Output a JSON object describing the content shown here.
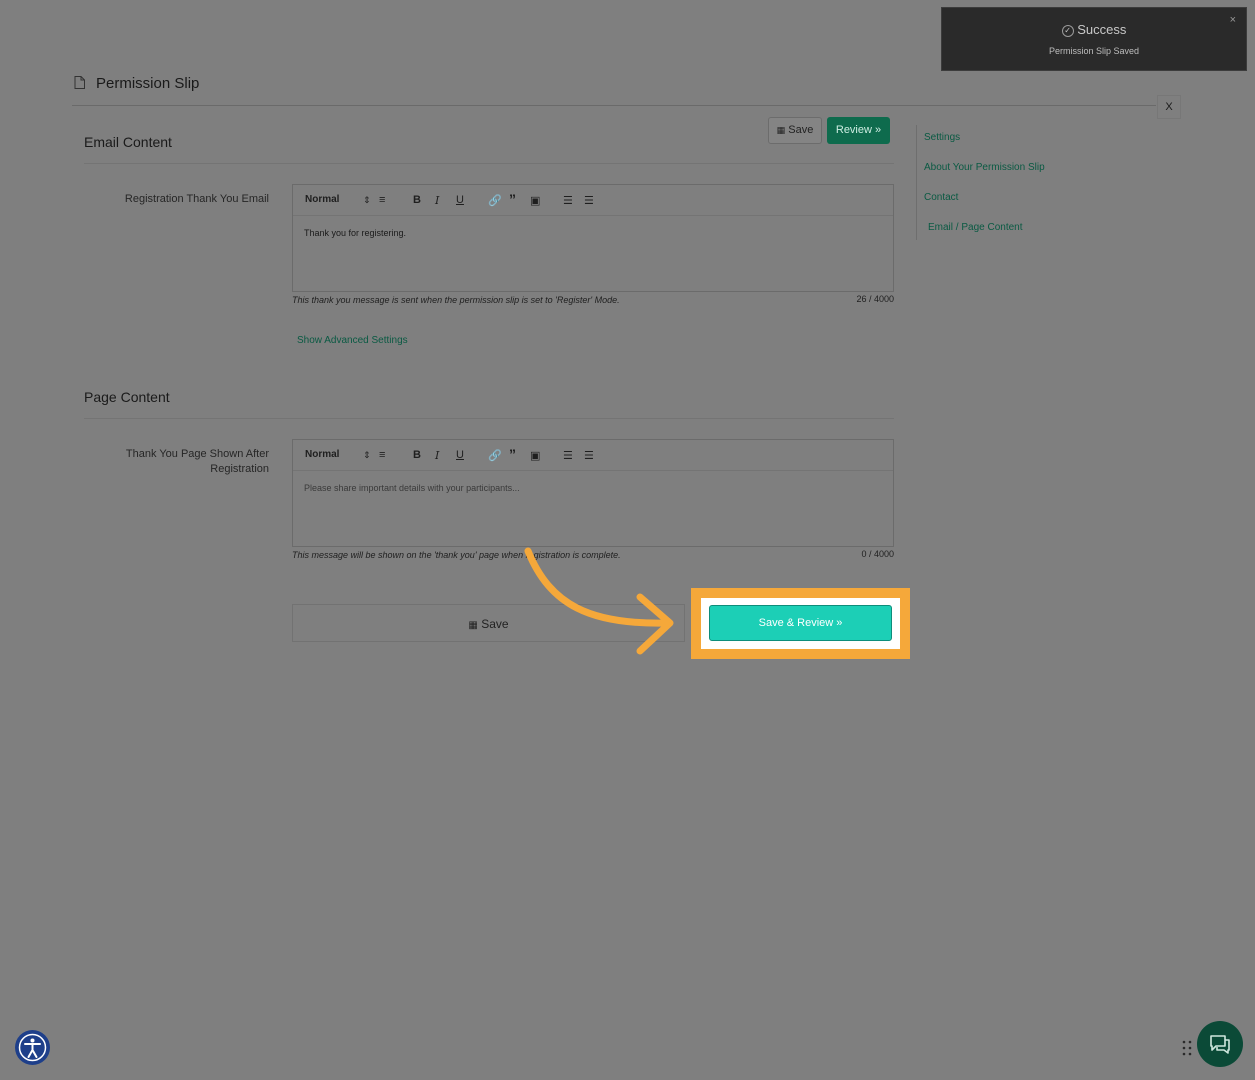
{
  "page": {
    "title": "Permission Slip",
    "close_label": "X"
  },
  "toolbar_top": {
    "save_label": "Save",
    "review_label": "Review »"
  },
  "email_section": {
    "title": "Email Content",
    "field_label": "Registration Thank You Email",
    "editor": {
      "format_select": "Normal",
      "content": "Thank you for registering.",
      "hint": "This thank you message is sent when the permission slip is set to 'Register' Mode.",
      "counter": "26 / 4000"
    },
    "advanced_link": "Show Advanced Settings"
  },
  "page_section": {
    "title": "Page Content",
    "field_label_line1": "Thank You Page Shown After",
    "field_label_line2": "Registration",
    "editor": {
      "format_select": "Normal",
      "placeholder": "Please share important details with your participants...",
      "hint": "This message will be shown on the 'thank you' page when registration is complete.",
      "counter": "0 / 4000"
    }
  },
  "footer_buttons": {
    "save_label": "Save",
    "save_review_label": "Save & Review »"
  },
  "side_nav": {
    "items": [
      "Settings",
      "About Your Permission Slip",
      "Contact",
      "Email / Page Content"
    ]
  },
  "toast": {
    "title": "Success",
    "message": "Permission Slip Saved",
    "close": "×"
  },
  "colors": {
    "overlay": "#7f7f7f",
    "accent_green": "#0e6b4d",
    "highlight_orange": "#f5a83a",
    "cta_teal": "#1ccfb6"
  }
}
